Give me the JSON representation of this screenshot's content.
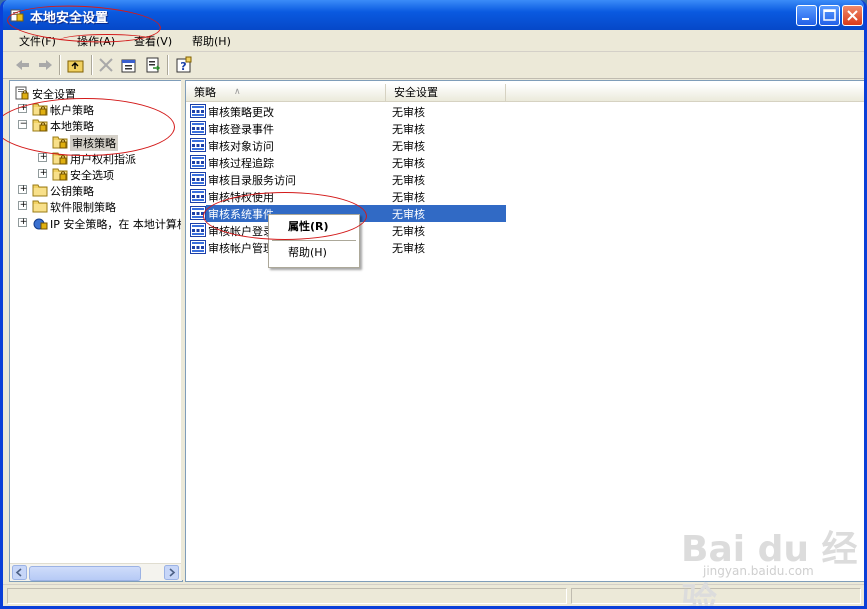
{
  "window": {
    "title": "本地安全设置"
  },
  "menubar": [
    "文件(F)",
    "操作(A)",
    "查看(V)",
    "帮助(H)"
  ],
  "tree": [
    {
      "label": "安全设置",
      "level": 0,
      "expander": ""
    },
    {
      "label": "帐户策略",
      "level": 1,
      "expander": "+"
    },
    {
      "label": "本地策略",
      "level": 1,
      "expander": "−"
    },
    {
      "label": "审核策略",
      "level": 2,
      "expander": "",
      "selected": true
    },
    {
      "label": "用户权利指派",
      "level": 2,
      "expander": "+"
    },
    {
      "label": "安全选项",
      "level": 2,
      "expander": "+"
    },
    {
      "label": "公钥策略",
      "level": 1,
      "expander": "+"
    },
    {
      "label": "软件限制策略",
      "level": 1,
      "expander": "+"
    },
    {
      "label": "IP 安全策略，在 本地计算机",
      "level": 1,
      "expander": "+"
    }
  ],
  "list": {
    "columns": [
      "策略",
      "安全设置"
    ],
    "rows": [
      {
        "name": "审核策略更改",
        "value": "无审核"
      },
      {
        "name": "审核登录事件",
        "value": "无审核"
      },
      {
        "name": "审核对象访问",
        "value": "无审核"
      },
      {
        "name": "审核过程追踪",
        "value": "无审核"
      },
      {
        "name": "审核目录服务访问",
        "value": "无审核"
      },
      {
        "name": "审核特权使用",
        "value": "无审核"
      },
      {
        "name": "审核系统事件",
        "value": "无审核",
        "selected": true
      },
      {
        "name": "审核帐户登录事件",
        "value": "无审核"
      },
      {
        "name": "审核帐户管理",
        "value": "无审核"
      }
    ]
  },
  "context_menu": {
    "properties": "属性(R)",
    "help": "帮助(H)"
  },
  "watermark": {
    "brand": "Bai du 经验",
    "url": "jingyan.baidu.com"
  },
  "colors": {
    "titlebar": "#0a5ae0",
    "selection": "#316ac5",
    "annotation": "#d31a1a"
  }
}
